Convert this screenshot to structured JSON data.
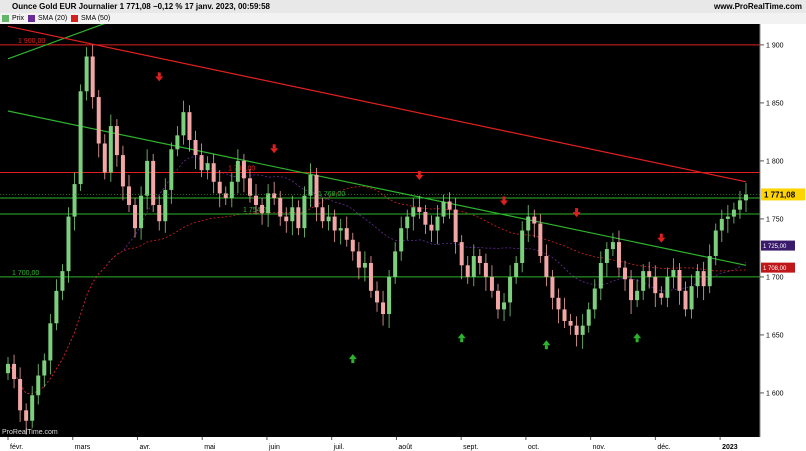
{
  "header": {
    "title": "Ounce Gold EUR  Journalier  1 771,08 −0,12 % 17 janv. 2023, 00:59:58",
    "brand": "www.ProRealTime.com"
  },
  "legend": [
    {
      "label": "Prix",
      "color": "#63b56a"
    },
    {
      "label": "SMA (20)",
      "color": "#6a2c9a"
    },
    {
      "label": "SMA (50)",
      "color": "#d62020"
    }
  ],
  "watermark": "ProRealTime.com",
  "chart_data": {
    "type": "candlestick",
    "x_labels": [
      "févr.",
      "mars",
      "avr.",
      "mai",
      "juin",
      "juil.",
      "août",
      "sept.",
      "oct.",
      "nov.",
      "déc.",
      "2023"
    ],
    "y_ticks": [
      "1 600",
      "1 650",
      "1 700",
      "1 750",
      "1 800",
      "1 850",
      "1 900"
    ],
    "ylim": [
      1562,
      1918
    ],
    "close_series": [
      1625,
      1612,
      1585,
      1576,
      1598,
      1615,
      1628,
      1660,
      1688,
      1705,
      1752,
      1780,
      1860,
      1890,
      1855,
      1815,
      1790,
      1830,
      1805,
      1778,
      1762,
      1742,
      1770,
      1800,
      1762,
      1748,
      1775,
      1810,
      1822,
      1842,
      1818,
      1805,
      1792,
      1798,
      1782,
      1772,
      1768,
      1782,
      1800,
      1785,
      1770,
      1762,
      1755,
      1772,
      1768,
      1752,
      1748,
      1760,
      1742,
      1770,
      1788,
      1760,
      1748,
      1752,
      1740,
      1742,
      1732,
      1722,
      1708,
      1712,
      1688,
      1678,
      1668,
      1700,
      1722,
      1742,
      1752,
      1760,
      1756,
      1745,
      1740,
      1752,
      1765,
      1758,
      1730,
      1710,
      1700,
      1718,
      1712,
      1700,
      1688,
      1672,
      1678,
      1700,
      1712,
      1740,
      1752,
      1746,
      1718,
      1700,
      1682,
      1672,
      1662,
      1658,
      1650,
      1658,
      1672,
      1690,
      1712,
      1724,
      1730,
      1708,
      1698,
      1680,
      1688,
      1705,
      1700,
      1686,
      1682,
      1700,
      1706,
      1688,
      1672,
      1692,
      1705,
      1692,
      1718,
      1740,
      1750,
      1752,
      1758,
      1766,
      1771.08
    ],
    "horizontal_levels": [
      {
        "label": "1 900,00",
        "value": 1900,
        "color": "#e02020"
      },
      {
        "label": "1 790,00",
        "value": 1790,
        "color": "#e02020"
      },
      {
        "label": "1 768,00",
        "value": 1768,
        "color": "#2db42d"
      },
      {
        "label": "1 754,20",
        "value": 1754.2,
        "color": "#2db42d"
      },
      {
        "label": "1 700,00",
        "value": 1700,
        "color": "#2db42d"
      }
    ],
    "current_price": {
      "label": "1 771,08",
      "value": 1771.08,
      "bg": "#ffd400"
    },
    "ma_markers": [
      {
        "label": "1 725,00",
        "value": 1727,
        "bg": "#3a1a6a"
      },
      {
        "label": "1 708,00",
        "value": 1708,
        "bg": "#c01818"
      }
    ],
    "down_arrows": [
      {
        "t": 25,
        "value": 1872
      },
      {
        "t": 44,
        "value": 1810
      },
      {
        "t": 68,
        "value": 1787
      },
      {
        "t": 82,
        "value": 1765
      },
      {
        "t": 94,
        "value": 1755
      },
      {
        "t": 108,
        "value": 1733
      }
    ],
    "up_arrows": [
      {
        "t": 57,
        "value": 1630
      },
      {
        "t": 75,
        "value": 1648
      },
      {
        "t": 89,
        "value": 1642
      },
      {
        "t": 104,
        "value": 1648
      }
    ],
    "trendlines": [
      {
        "p1": {
          "t": 0,
          "value": 1888
        },
        "p2": {
          "t": 42,
          "value": 1968
        },
        "color": "#2db42d"
      },
      {
        "p1": {
          "t": 0,
          "value": 1916
        },
        "p2": {
          "t": 122,
          "value": 1782
        },
        "color": "#e02020"
      },
      {
        "p1": {
          "t": 0,
          "value": 1843
        },
        "p2": {
          "t": 122,
          "value": 1710
        },
        "color": "#2db42d"
      }
    ]
  }
}
